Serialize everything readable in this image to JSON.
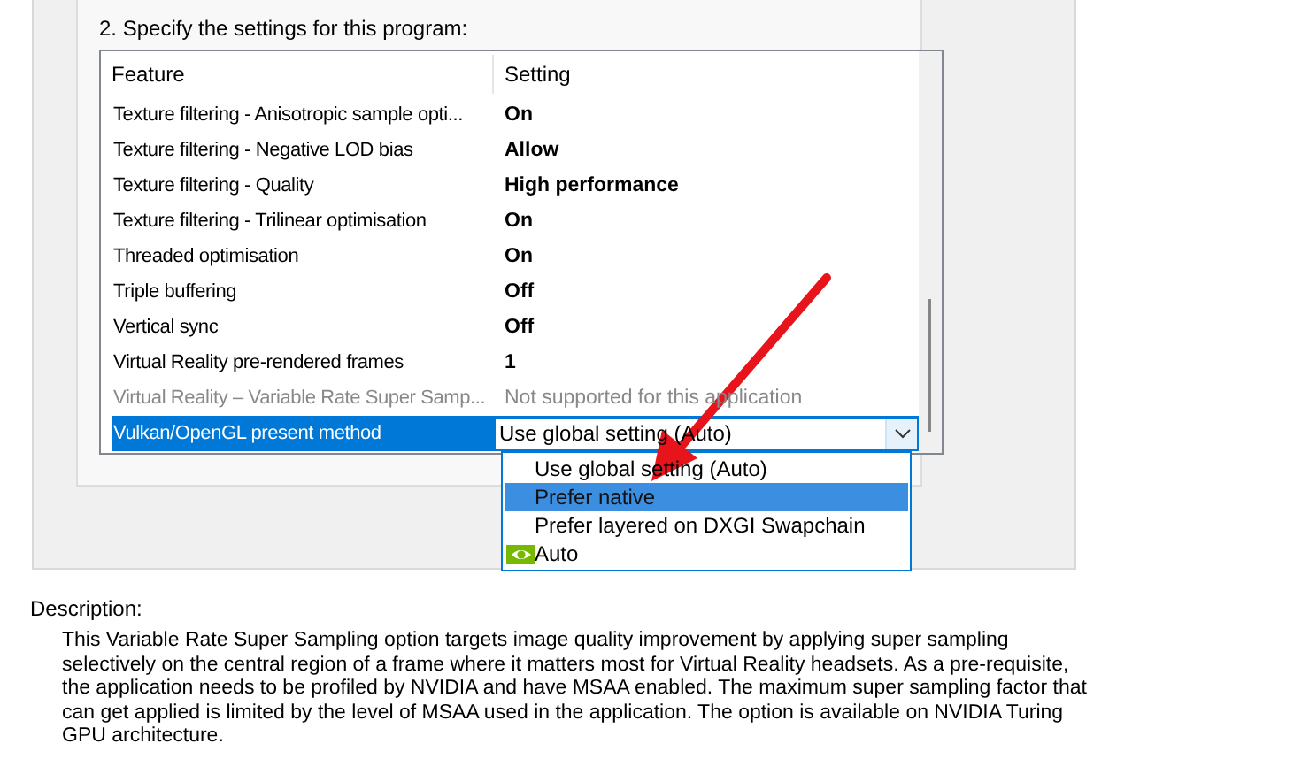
{
  "instruction": "2. Specify the settings for this program:",
  "table": {
    "columns": [
      "Feature",
      "Setting"
    ],
    "rows": [
      {
        "feature": "Texture filtering - Anisotropic sample opti...",
        "setting": "On",
        "disabled": false,
        "selected": false
      },
      {
        "feature": "Texture filtering - Negative LOD bias",
        "setting": "Allow",
        "disabled": false,
        "selected": false
      },
      {
        "feature": "Texture filtering - Quality",
        "setting": "High performance",
        "disabled": false,
        "selected": false
      },
      {
        "feature": "Texture filtering - Trilinear optimisation",
        "setting": "On",
        "disabled": false,
        "selected": false
      },
      {
        "feature": "Threaded optimisation",
        "setting": "On",
        "disabled": false,
        "selected": false
      },
      {
        "feature": "Triple buffering",
        "setting": "Off",
        "disabled": false,
        "selected": false
      },
      {
        "feature": "Vertical sync",
        "setting": "Off",
        "disabled": false,
        "selected": false
      },
      {
        "feature": "Virtual Reality pre-rendered frames",
        "setting": "1",
        "disabled": false,
        "selected": false
      },
      {
        "feature": "Virtual Reality – Variable Rate Super Samp...",
        "setting": "Not supported for this application",
        "disabled": true,
        "selected": false
      },
      {
        "feature": "Vulkan/OpenGL present method",
        "setting": "Use global setting (Auto)",
        "disabled": false,
        "selected": true
      }
    ]
  },
  "dropdown": {
    "expanded": true,
    "options": [
      {
        "label": "Use global setting (Auto)",
        "selected": false,
        "kind": "text"
      },
      {
        "label": "Prefer native",
        "selected": true,
        "kind": "text"
      },
      {
        "label": "Prefer layered on DXGI Swapchain",
        "selected": false,
        "kind": "text"
      },
      {
        "label": "Auto",
        "selected": false,
        "kind": "logo"
      }
    ]
  },
  "description": {
    "label": "Description:",
    "text": "This Variable Rate Super Sampling option targets image quality improvement by applying super sampling selectively on the central region of a frame where it matters most for Virtual Reality headsets. As a pre-requisite, the application needs to be profiled by NVIDIA and have MSAA enabled. The maximum super sampling factor that can get applied is limited by the level of MSAA used in the application. The option is available on NVIDIA Turing GPU architecture."
  }
}
